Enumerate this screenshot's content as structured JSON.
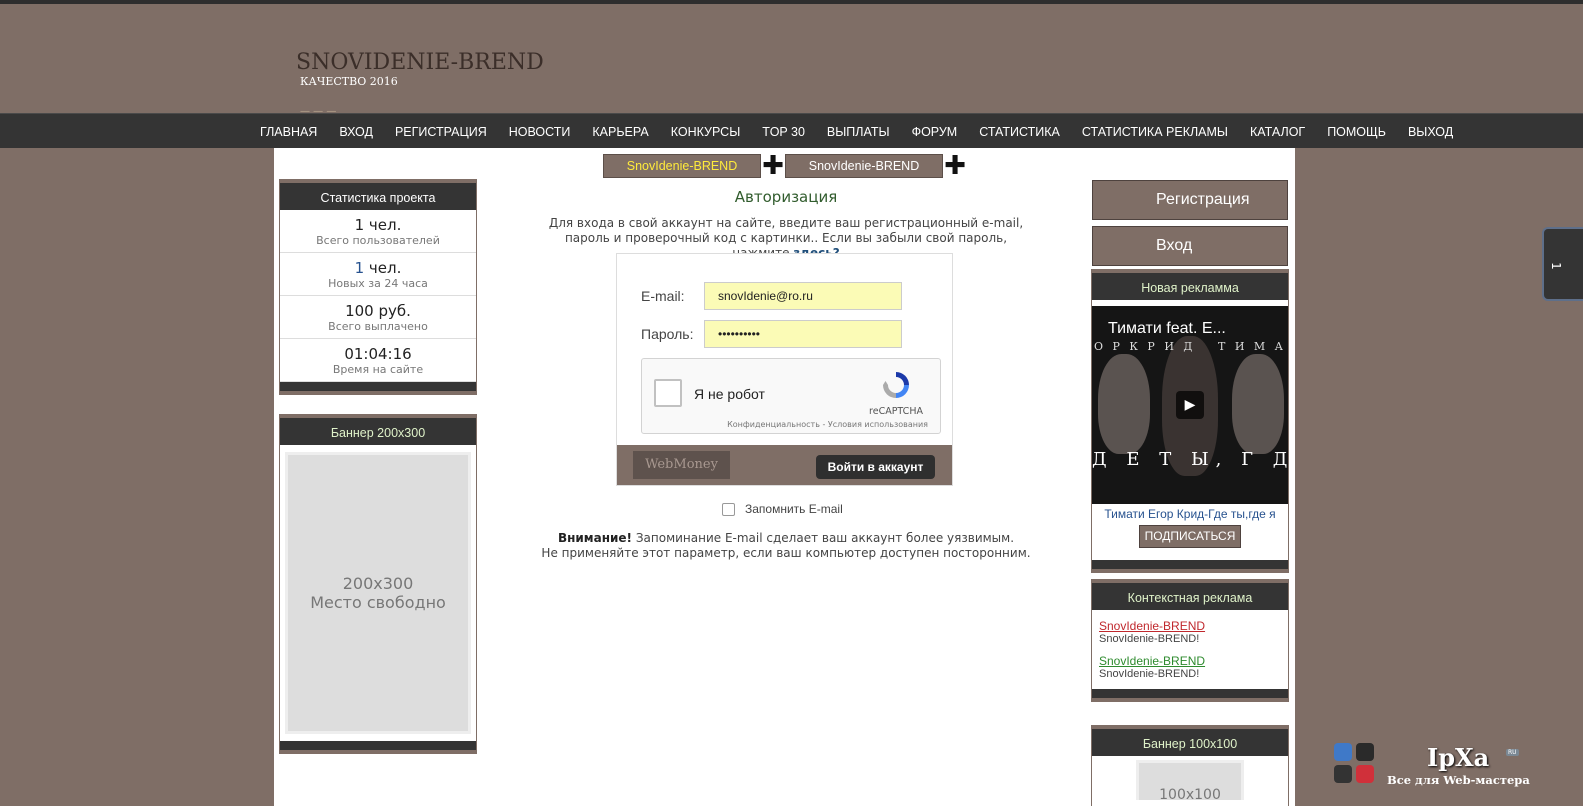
{
  "site": {
    "logo_title": "SNOVIDENIE-BREND",
    "logo_subtitle": "КАЧЕСТВО 2016",
    "logo_dots": "— — —"
  },
  "nav": {
    "items": [
      {
        "label": "ГЛАВНАЯ"
      },
      {
        "label": "ВХОД"
      },
      {
        "label": "РЕГИСТРАЦИЯ"
      },
      {
        "label": "НОВОСТИ"
      },
      {
        "label": "КАРЬЕРА"
      },
      {
        "label": "КОНКУРСЫ"
      },
      {
        "label": "TOP 30"
      },
      {
        "label": "ВЫПЛАТЫ"
      },
      {
        "label": "ФОРУМ"
      },
      {
        "label": "СТАТИСТИКА"
      },
      {
        "label": "СТАТИСТИКА РЕКЛАМЫ"
      },
      {
        "label": "КАТАЛОГ"
      },
      {
        "label": "ПОМОЩЬ"
      },
      {
        "label": "ВЫХОД"
      }
    ]
  },
  "tabs": {
    "first": "SnovIdenie-BREND",
    "second": "SnovIdenie-BREND",
    "plus": "✚"
  },
  "stats_box": {
    "title": "Статистика проекта",
    "items": [
      {
        "value_num": "1",
        "value_unit": " чел.",
        "label": "Всего пользователей"
      },
      {
        "value_num": "1",
        "value_unit": " чел.",
        "label": "Новых за 24 часа"
      },
      {
        "value_num": "100 руб.",
        "value_unit": "",
        "label": "Всего выплачено"
      },
      {
        "value_num": "01:04:16",
        "value_unit": "",
        "label": "Время на сайте"
      }
    ]
  },
  "banner_left": {
    "title": "Баннер 200х300",
    "size": "200x300",
    "text": "Место свободно"
  },
  "auth": {
    "title": "Авторизация",
    "intro_text": "Для входа в свой аккаунт на сайте, введите ваш регистрационный e-mail, пароль и проверочный код с картинки.. Если вы забыли свой пароль, нажмите ",
    "intro_link": "здесь?",
    "email_label": "E-mail:",
    "email_value": "snovIdenie@ro.ru",
    "password_label": "Пароль:",
    "password_value": "••••••••••",
    "captcha_label": "Я не робот",
    "captcha_brand": "reCAPTCHA",
    "captcha_legal": "Конфиденциальность - Условия использования",
    "webmoney": "WebMoney",
    "login_button": "Войти в аккаунт",
    "remember_label": "Запомнить E-mail",
    "warning_bold": "Внимание!",
    "warning_text": " Запоминание E-mail сделает ваш аккаунт более уязвимым.",
    "warning_text2": "Не применяйте этот параметр, если ваш компьютер доступен посторонним."
  },
  "right": {
    "register_button": "Регистрация",
    "login_button": "Вход",
    "new_ad_title": "Новая рекламма",
    "video_title": "Тимати feat. Е...",
    "video_top_left": "О Р   К Р И Д",
    "video_top_right": "Т И М А",
    "video_bottom": "Д Е  Т Ы,  Г Д Е",
    "video_caption": "Тимати Егор Крид-Где ты,где я",
    "subscribe": "ПОДПИСАТЬСЯ",
    "context_title": "Контекстная реклама",
    "context_ads": [
      {
        "title": "SnovIdenie-BREND",
        "desc": "SnovIdenie-BREND!",
        "color": "#c0282d"
      },
      {
        "title": "SnovIdenie-BREND",
        "desc": "SnovIdenie-BREND!",
        "color": "#2e8b2e"
      }
    ],
    "banner100_title": "Баннер 100х100",
    "banner100_text": "100x100"
  },
  "side_tab": "1",
  "ipxa": {
    "logo": "IpXa",
    "ru": "RU",
    "tagline": "Все для Web-мастера"
  }
}
